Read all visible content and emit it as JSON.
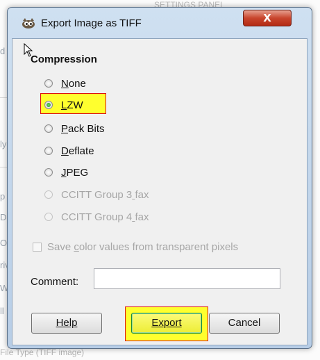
{
  "background": {
    "top_text": "SETTINGS PANEL",
    "side_letters": [
      "d",
      "ly",
      "p",
      "Dis",
      "O",
      "riv",
      "W",
      "ll"
    ],
    "bottom_text": "File Type (TIFF image)"
  },
  "dialog": {
    "title": "Export Image as TIFF",
    "close_label": "X",
    "section_title": "Compression",
    "options": [
      {
        "label": "None",
        "underline_index": 0,
        "checked": false,
        "disabled": false
      },
      {
        "label": "LZW",
        "underline_index": 0,
        "checked": true,
        "disabled": false
      },
      {
        "label": "Pack Bits",
        "underline_index": 0,
        "checked": false,
        "disabled": false
      },
      {
        "label": "Deflate",
        "underline_index": 0,
        "checked": false,
        "disabled": false
      },
      {
        "label": "JPEG",
        "underline_index": 0,
        "checked": false,
        "disabled": false
      },
      {
        "label": "CCITT Group 3 fax",
        "underline_index": 13,
        "checked": false,
        "disabled": true
      },
      {
        "label": "CCITT Group 4 fax",
        "underline_index": 13,
        "checked": false,
        "disabled": true
      }
    ],
    "save_color_label": "Save color values from transparent pixels",
    "save_color_checked": false,
    "comment_label": "Comment:",
    "comment_value": "",
    "buttons": {
      "help": "Help",
      "export": "Export",
      "cancel": "Cancel"
    }
  },
  "colors": {
    "highlight": "#ffff2e",
    "highlight_border": "#dd1111",
    "radio_checked": "#1e8a1a"
  },
  "icons": {
    "title_icon": "gimp-wilber-icon",
    "cursor": "mouse-pointer-icon"
  }
}
